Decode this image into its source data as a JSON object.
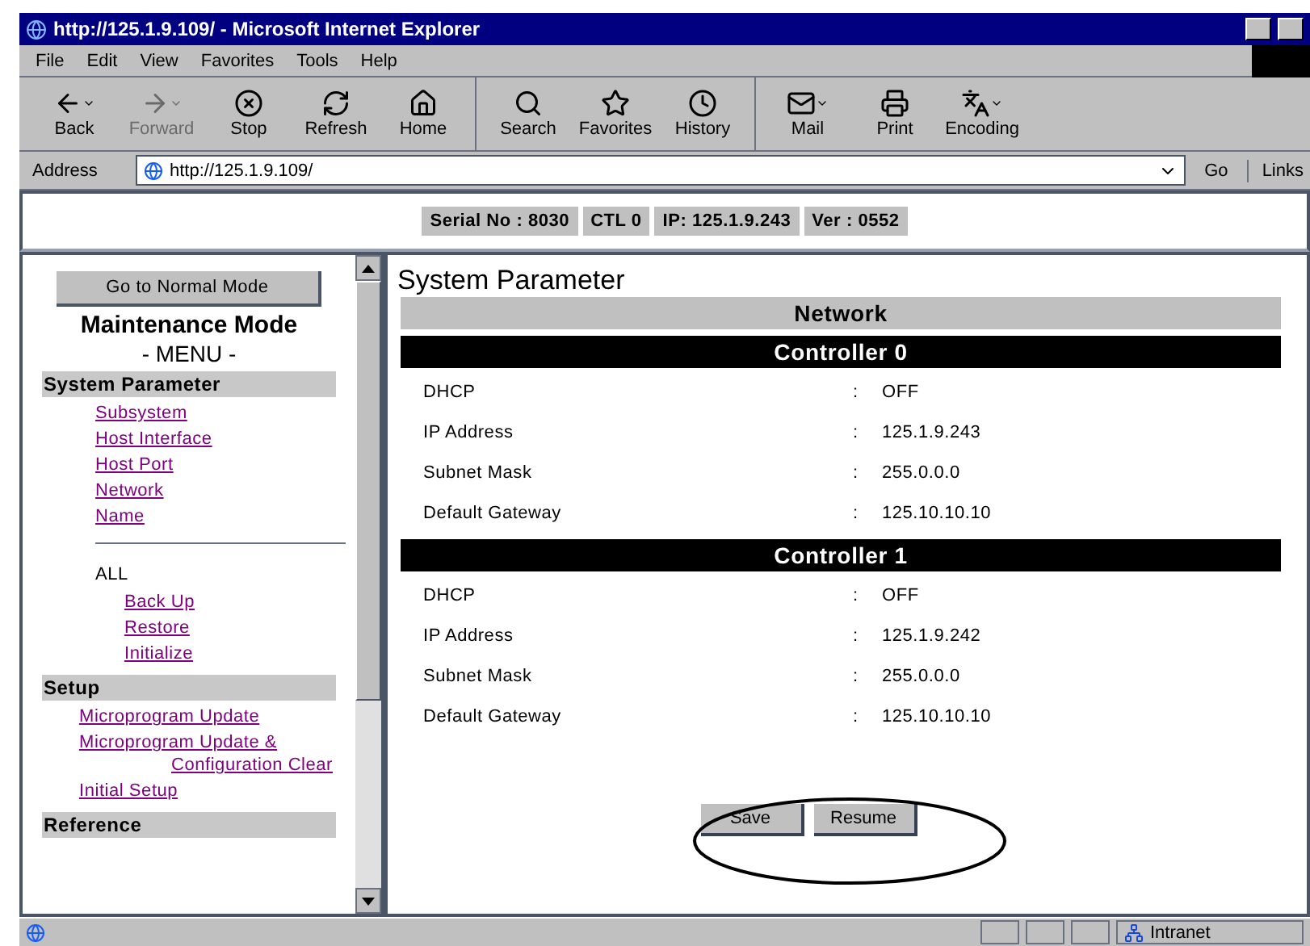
{
  "window": {
    "title": "http://125.1.9.109/ - Microsoft Internet Explorer"
  },
  "menu": [
    "File",
    "Edit",
    "View",
    "Favorites",
    "Tools",
    "Help"
  ],
  "toolbar": [
    [
      {
        "label": "Back",
        "kind": "back",
        "disabled": false,
        "dropdown": true
      },
      {
        "label": "Forward",
        "kind": "forward",
        "disabled": true,
        "dropdown": true
      },
      {
        "label": "Stop",
        "kind": "stop",
        "disabled": false,
        "dropdown": false
      },
      {
        "label": "Refresh",
        "kind": "refresh",
        "disabled": false,
        "dropdown": false
      },
      {
        "label": "Home",
        "kind": "home",
        "disabled": false,
        "dropdown": false
      }
    ],
    [
      {
        "label": "Search",
        "kind": "search",
        "disabled": false,
        "dropdown": false
      },
      {
        "label": "Favorites",
        "kind": "favorites",
        "disabled": false,
        "dropdown": false
      },
      {
        "label": "History",
        "kind": "history",
        "disabled": false,
        "dropdown": false
      }
    ],
    [
      {
        "label": "Mail",
        "kind": "mail",
        "disabled": false,
        "dropdown": true
      },
      {
        "label": "Print",
        "kind": "print",
        "disabled": false,
        "dropdown": false
      },
      {
        "label": "Encoding",
        "kind": "encoding",
        "disabled": false,
        "dropdown": true
      }
    ]
  ],
  "address": {
    "label": "Address",
    "value": "http://125.1.9.109/",
    "go": "Go",
    "links": "Links"
  },
  "info_bar": [
    "Serial No : 8030",
    "CTL 0",
    "IP: 125.1.9.243",
    "Ver : 0552"
  ],
  "sidebar": {
    "button": "Go to Normal Mode",
    "title": "Maintenance Mode",
    "subtitle": "- MENU -",
    "sections": [
      {
        "heading": "System Parameter",
        "items": [
          {
            "kind": "link",
            "label": "Subsystem"
          },
          {
            "kind": "link",
            "label": "Host Interface"
          },
          {
            "kind": "link",
            "label": "Host Port"
          },
          {
            "kind": "link",
            "label": "Network"
          },
          {
            "kind": "link",
            "label": "Name"
          },
          {
            "kind": "divider"
          },
          {
            "kind": "text",
            "label": "ALL",
            "children": [
              {
                "kind": "link",
                "label": "Back Up"
              },
              {
                "kind": "link",
                "label": "Restore"
              },
              {
                "kind": "link",
                "label": "Initialize"
              }
            ]
          }
        ]
      },
      {
        "heading": "Setup",
        "items": [
          {
            "kind": "link",
            "label": "Microprogram Update"
          },
          {
            "kind": "link",
            "label": "Microprogram Update &",
            "continuation": "Configuration Clear"
          },
          {
            "kind": "link",
            "label": "Initial Setup"
          }
        ]
      },
      {
        "heading": "Reference"
      }
    ]
  },
  "content": {
    "title": "System Parameter",
    "section": "Network",
    "controllers": [
      {
        "name": "Controller 0",
        "rows": [
          {
            "label": "DHCP",
            "value": "OFF"
          },
          {
            "label": "IP Address",
            "value": "125.1.9.243"
          },
          {
            "label": "Subnet Mask",
            "value": "255.0.0.0"
          },
          {
            "label": "Default Gateway",
            "value": "125.10.10.10"
          }
        ]
      },
      {
        "name": "Controller 1",
        "rows": [
          {
            "label": "DHCP",
            "value": "OFF"
          },
          {
            "label": "IP Address",
            "value": "125.1.9.242"
          },
          {
            "label": "Subnet Mask",
            "value": "255.0.0.0"
          },
          {
            "label": "Default Gateway",
            "value": "125.10.10.10"
          }
        ]
      }
    ],
    "separator": ":",
    "buttons": [
      "Save",
      "Resume"
    ]
  },
  "status_bar": {
    "zone": "Intranet"
  }
}
